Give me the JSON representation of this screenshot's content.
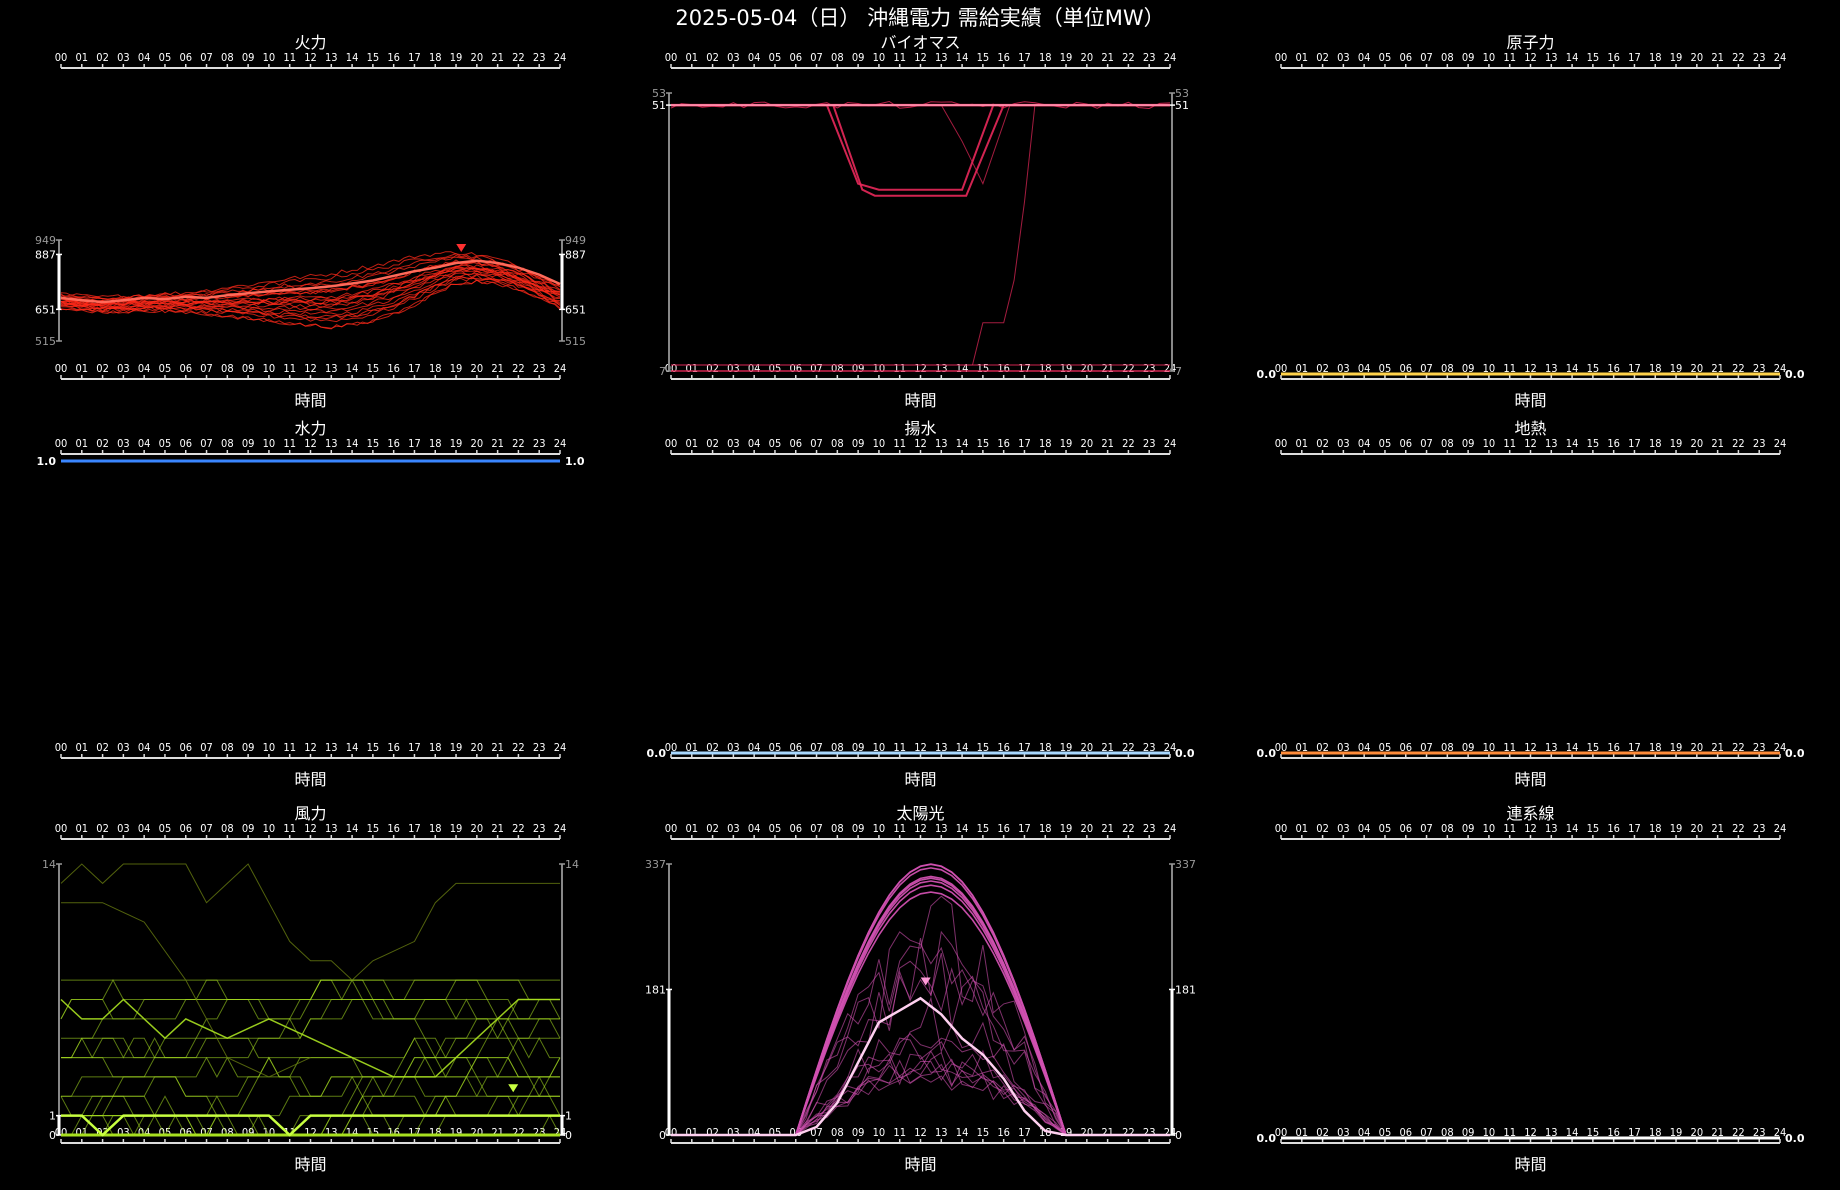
{
  "title": "2025-05-04（日） 沖縄電力 需給実績（単位MW）",
  "x_axis_label": "時間",
  "hour_ticks": [
    "00",
    "01",
    "02",
    "03",
    "04",
    "05",
    "06",
    "07",
    "08",
    "09",
    "10",
    "11",
    "12",
    "13",
    "14",
    "15",
    "16",
    "17",
    "18",
    "19",
    "20",
    "21",
    "22",
    "23",
    "24"
  ],
  "chart_data": [
    {
      "type": "line",
      "title": "火力",
      "color": "#ff2a1a",
      "ylim": [
        515,
        949
      ],
      "y_labels": [
        {
          "value": 949,
          "text": "949",
          "style": "max"
        },
        {
          "value": 887,
          "text": "887",
          "style": "main"
        },
        {
          "value": 651,
          "text": "651",
          "style": "main"
        },
        {
          "value": 515,
          "text": "515",
          "style": "min"
        }
      ],
      "today": [
        700,
        690,
        682,
        690,
        700,
        695,
        705,
        700,
        712,
        720,
        728,
        735,
        742,
        750,
        762,
        775,
        795,
        815,
        830,
        850,
        860,
        850,
        830,
        800,
        760
      ],
      "peak": {
        "x": 19.25,
        "y": 880
      },
      "band": {
        "lo": [
          660,
          645,
          640,
          640,
          645,
          645,
          640,
          630,
          620,
          610,
          600,
          590,
          580,
          575,
          580,
          600,
          630,
          670,
          720,
          760,
          770,
          760,
          740,
          700,
          660
        ],
        "hi": [
          720,
          710,
          705,
          710,
          715,
          720,
          725,
          735,
          750,
          760,
          775,
          790,
          800,
          810,
          830,
          845,
          865,
          885,
          895,
          900,
          890,
          870,
          840,
          800,
          760
        ]
      },
      "n_history": 22
    },
    {
      "type": "line",
      "title": "バイオマス",
      "color": "#e8285a",
      "ylim": [
        7,
        53
      ],
      "y_labels": [
        {
          "value": 53,
          "text": "53",
          "style": "max"
        },
        {
          "value": 51,
          "text": "51",
          "style": "main"
        },
        {
          "value": 7,
          "text": "7",
          "style": "min"
        }
      ],
      "today": [
        51,
        51,
        51,
        51,
        51,
        51,
        51,
        51,
        51,
        51,
        51,
        51,
        51,
        51,
        51,
        51,
        51,
        51,
        51,
        51,
        51,
        51,
        51,
        51,
        51
      ]
    },
    {
      "type": "line",
      "title": "原子力",
      "color": "#ffd24a",
      "ylim": [
        0,
        1
      ],
      "y_labels": [
        {
          "value": 0,
          "text": "0.0",
          "style": "main"
        }
      ],
      "flat": 0
    },
    {
      "type": "line",
      "title": "水力",
      "color": "#3a86ff",
      "ylim": [
        0,
        1
      ],
      "y_labels": [
        {
          "value": 1,
          "text": "1.0",
          "style": "main"
        }
      ],
      "flat": 1
    },
    {
      "type": "line",
      "title": "揚水",
      "color": "#a8d8ff",
      "ylim": [
        0,
        1
      ],
      "y_labels": [
        {
          "value": 0,
          "text": "0.0",
          "style": "main"
        }
      ],
      "flat": 0
    },
    {
      "type": "line",
      "title": "地熱",
      "color": "#ff8c3a",
      "ylim": [
        0,
        1
      ],
      "y_labels": [
        {
          "value": 0,
          "text": "0.0",
          "style": "main"
        }
      ],
      "flat": 0
    },
    {
      "type": "line",
      "title": "風力",
      "color": "#a8e020",
      "ylim": [
        0,
        14
      ],
      "y_labels": [
        {
          "value": 14,
          "text": "14",
          "style": "min"
        },
        {
          "value": 1,
          "text": "1",
          "style": "main"
        },
        {
          "value": 0,
          "text": "0",
          "style": "main"
        }
      ],
      "today": [
        1,
        1,
        0,
        1,
        1,
        1,
        1,
        1,
        1,
        1,
        1,
        0,
        1,
        1,
        1,
        1,
        1,
        1,
        1,
        1,
        1,
        1,
        1,
        1,
        1
      ],
      "peak": {
        "x": 21.75,
        "y": 2
      }
    },
    {
      "type": "line",
      "title": "太陽光",
      "color": "#d050b0",
      "ylim": [
        0,
        337
      ],
      "y_labels": [
        {
          "value": 337,
          "text": "337",
          "style": "min"
        },
        {
          "value": 181,
          "text": "181",
          "style": "main"
        },
        {
          "value": 0,
          "text": "0",
          "style": "main"
        }
      ],
      "today": [
        0,
        0,
        0,
        0,
        0,
        0,
        0,
        10,
        40,
        90,
        140,
        155,
        170,
        150,
        120,
        100,
        70,
        30,
        5,
        0,
        0,
        0,
        0,
        0,
        0
      ],
      "peak": {
        "x": 12.25,
        "y": 181
      }
    },
    {
      "type": "line",
      "title": "連系線",
      "color": "#ffffff",
      "ylim": [
        0,
        1
      ],
      "y_labels": [
        {
          "value": 0,
          "text": "0.0",
          "style": "main"
        }
      ],
      "flat": 0
    }
  ]
}
